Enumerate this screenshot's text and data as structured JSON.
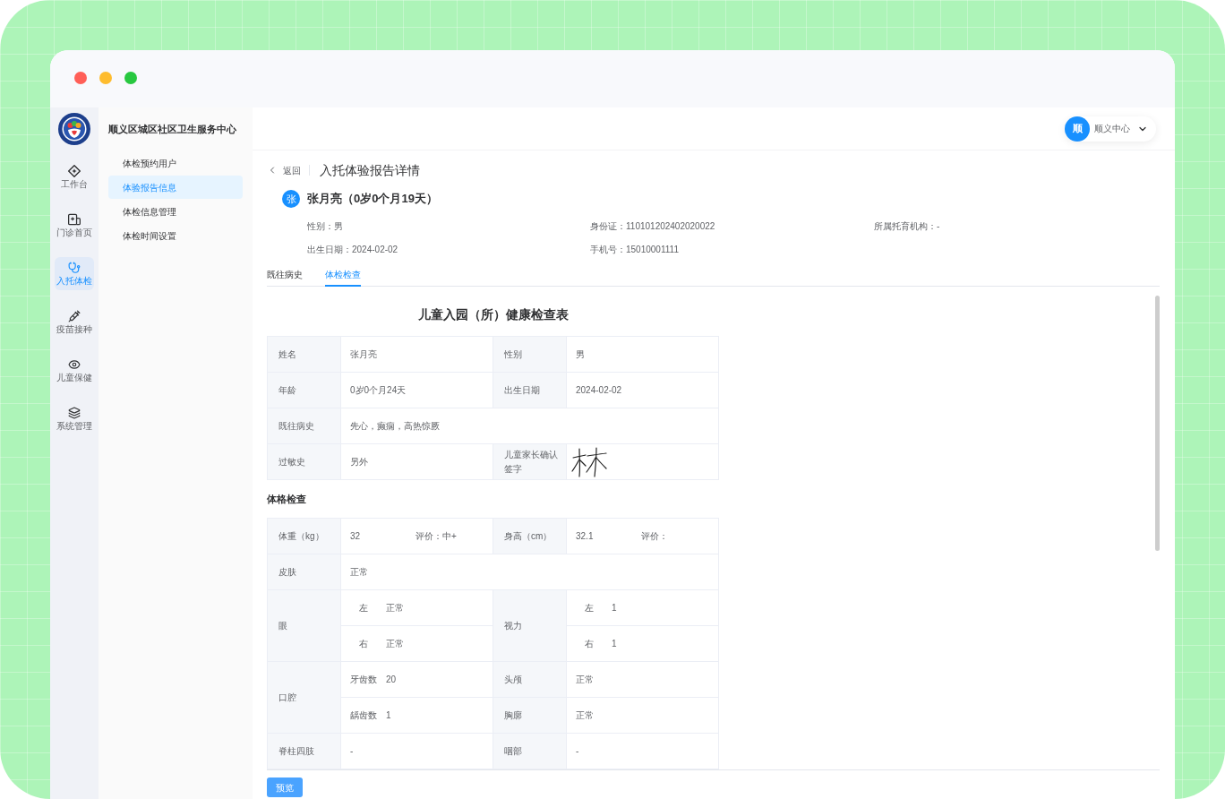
{
  "rail": {
    "items": [
      {
        "kind": "workbench",
        "label": "工作台",
        "selected": false
      },
      {
        "kind": "clinic",
        "label": "门诊首页",
        "selected": false
      },
      {
        "kind": "checkup",
        "label": "入托体检",
        "selected": true
      },
      {
        "kind": "vaccine",
        "label": "疫苗接种",
        "selected": false
      },
      {
        "kind": "childcare",
        "label": "儿童保健",
        "selected": false
      },
      {
        "kind": "system",
        "label": "系统管理",
        "selected": false
      }
    ]
  },
  "org_nav": {
    "title": "顺义区城区社区卫生服务中心",
    "items": [
      {
        "label": "体检预约用户",
        "selected": false
      },
      {
        "label": "体验报告信息",
        "selected": true
      },
      {
        "label": "体检信息管理",
        "selected": false
      },
      {
        "label": "体检时间设置",
        "selected": false
      }
    ]
  },
  "header": {
    "user": {
      "avatar": "顺",
      "name": "顺义中心"
    }
  },
  "page": {
    "back": "返回",
    "title": "入托体验报告详情"
  },
  "patient": {
    "avatar": "张",
    "name": "张月亮（0岁0个月19天）",
    "fields": [
      {
        "label": "性别：",
        "value": "男"
      },
      {
        "label": "身份证：",
        "value": "110101202402020022"
      },
      {
        "label": "所属托育机构：",
        "value": "-"
      },
      {
        "label": "出生日期：",
        "value": "2024-02-02"
      },
      {
        "label": "手机号：",
        "value": "15010001111"
      }
    ]
  },
  "tabs": [
    {
      "label": "既往病史",
      "selected": false
    },
    {
      "label": "体检检查",
      "selected": true
    }
  ],
  "report": {
    "title": "儿童入园（所）健康检查表",
    "basic_table": {
      "rows": [
        {
          "pairs": [
            {
              "kind": "text",
              "label": "姓名",
              "value": "张月亮"
            },
            {
              "kind": "text",
              "label": "性别",
              "value": "男"
            }
          ]
        },
        {
          "pairs": [
            {
              "kind": "text",
              "label": "年龄",
              "value": "0岁0个月24天"
            },
            {
              "kind": "text",
              "label": "出生日期",
              "value": "2024-02-02"
            }
          ]
        },
        {
          "pairs": [
            {
              "kind": "text",
              "label": "既往病史",
              "value": "先心，癫痫，高热惊厥"
            }
          ]
        },
        {
          "pairs": [
            {
              "kind": "text",
              "label": "过敏史",
              "value": "另外"
            },
            {
              "kind": "signature",
              "label": "儿童家长确认签字"
            }
          ]
        }
      ]
    },
    "section_title": "体格检查",
    "exam_table": {
      "rows": [
        {
          "pairs": [
            {
              "kind": "rated",
              "label": "体重（kg）",
              "value": "32",
              "rating": "评价：中+"
            },
            {
              "kind": "rated",
              "label": "身高（cm）",
              "value": "32.1",
              "rating": "评价："
            }
          ]
        },
        {
          "pairs": [
            {
              "kind": "text",
              "label": "皮肤",
              "value": "正常"
            }
          ]
        },
        {
          "pairs": [
            {
              "kind": "sides",
              "label": "眼",
              "entries": [
                {
                  "label": "左",
                  "value": "正常"
                },
                {
                  "label": "右",
                  "value": "正常"
                }
              ]
            },
            {
              "kind": "sides",
              "label": "视力",
              "entries": [
                {
                  "label": "左",
                  "value": "1"
                },
                {
                  "label": "右",
                  "value": "1"
                }
              ]
            }
          ]
        },
        {
          "pairs": [
            {
              "kind": "counts",
              "label": "口腔",
              "entries": [
                {
                  "label": "牙齿数",
                  "value": "20"
                },
                {
                  "label": "龋齿数",
                  "value": "1"
                }
              ]
            },
            {
              "kind": "pairs",
              "entries": [
                {
                  "label": "头颅",
                  "value": "正常"
                },
                {
                  "label": "胸廓",
                  "value": "正常"
                }
              ]
            }
          ]
        },
        {
          "pairs": [
            {
              "kind": "text",
              "label": "脊柱四肢",
              "value": "-"
            },
            {
              "kind": "text",
              "label": "咽部",
              "value": "-"
            }
          ]
        }
      ]
    }
  },
  "actions": {
    "preview": "预览"
  }
}
